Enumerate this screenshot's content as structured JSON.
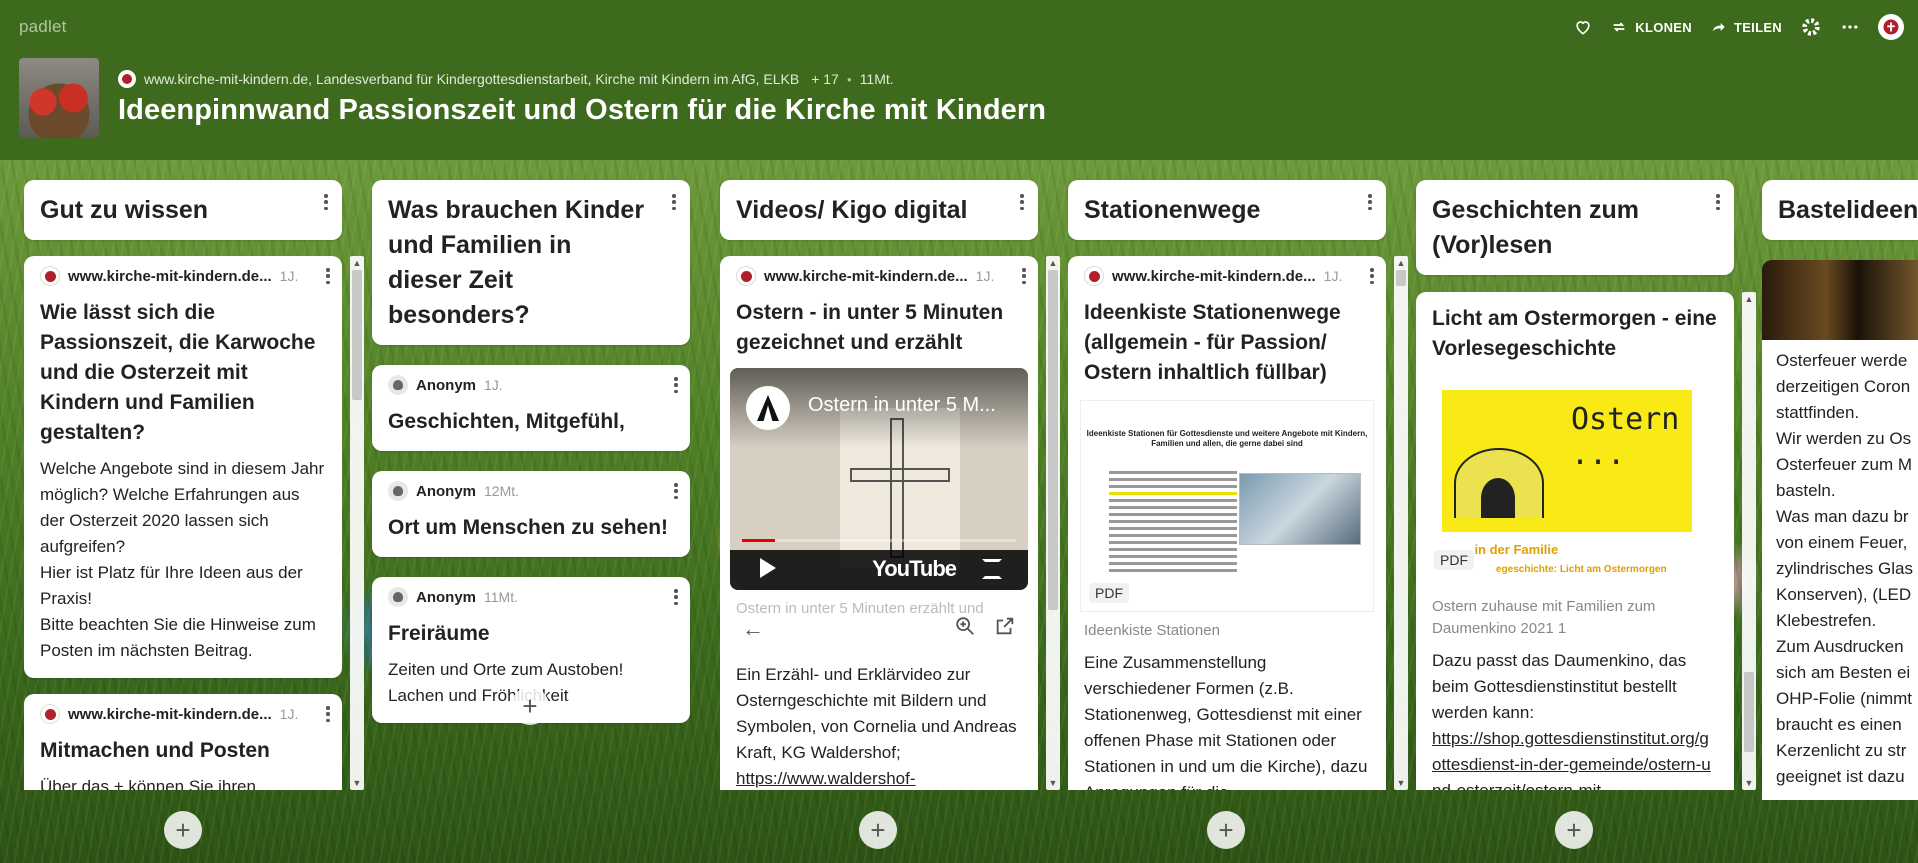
{
  "brand": "padlet",
  "actions": {
    "clone": "KLONEN",
    "share": "TEILEN"
  },
  "header": {
    "author": "www.kirche-mit-kindern.de, Landesverband für Kindergottesdienstarbeit, Kirche mit Kindern im AfG, ELKB",
    "contributors": "+ 17",
    "age": "11Mt.",
    "title": "Ideenpinnwand Passionszeit und Ostern für die Kirche mit Kindern"
  },
  "columns": [
    {
      "title": "Gut zu wissen",
      "cards": [
        {
          "author": "www.kirche-mit-kindern.de...",
          "time": "1J.",
          "title": "Wie lässt sich die Passionszeit, die Karwoche und die Osterzeit mit Kindern und Familien gestalten?",
          "body": [
            "Welche Angebote sind in diesem Jahr möglich? Welche Erfahrungen aus der Osterzeit 2020 lassen sich aufgreifen?",
            "Hier ist Platz für Ihre Ideen aus der Praxis!",
            "Bitte beachten Sie die Hinweise zum Posten im nächsten Beitrag."
          ]
        },
        {
          "author": "www.kirche-mit-kindern.de...",
          "time": "1J.",
          "title": "Mitmachen und Posten",
          "body": [
            "Über das + können Sie ihren"
          ]
        }
      ]
    },
    {
      "title": "Was brauchen Kinder und Familien in dieser Zeit besonders?",
      "cards": [
        {
          "author": "Anonym",
          "time": "1J.",
          "title": "Geschichten, Mitgefühl,"
        },
        {
          "author": "Anonym",
          "time": "12Mt.",
          "title": "Ort um Menschen zu sehen!"
        },
        {
          "author": "Anonym",
          "time": "11Mt.",
          "title": "Freiräume",
          "body": [
            "Zeiten und Orte zum Austoben! Lachen und Fröhlichkeit"
          ]
        }
      ]
    },
    {
      "title": "Videos/ Kigo digital",
      "cards": [
        {
          "author": "www.kirche-mit-kindern.de...",
          "time": "1J.",
          "title": "Ostern - in unter 5 Minuten gezeichnet und erzählt",
          "video_title": "Ostern in unter 5 M...",
          "video_brand": "YouTube",
          "ghost_caption": "Ostern in unter 5 Minuten erzählt und",
          "body": "Ein Erzähl- und Erklärvideo zur Osterngeschichte mit Bildern und Symbolen, von Cornelia und Andreas Kraft, KG Waldershof;",
          "link": "https://www.waldershof-evangelisch.de/"
        }
      ]
    },
    {
      "title": "Stationenwege",
      "cards": [
        {
          "author": "www.kirche-mit-kindern.de...",
          "time": "1J.",
          "title": "Ideenkiste Stationenwege (allgemein - für Passion/ Ostern inhaltlich füllbar)",
          "pdf_heading": "Ideenkiste Stationen für Gottesdienste und weitere Angebote mit Kindern, Familien und allen, die gerne dabei sind",
          "badge": "PDF",
          "file": "Ideenkiste Stationen",
          "body": "Eine Zusammenstellung verschiedener Formen (z.B. Stationenweg, Gottesdienst mit einer offenen Phase mit Stationen oder Stationen in und um die Kirche), dazu Anregungen für die"
        }
      ]
    },
    {
      "title": "Geschichten zum (Vor)lesen",
      "cards": [
        {
          "title": "Licht am Ostermorgen - eine Vorlesegeschichte",
          "pdf_word": "Ostern ...",
          "pdf_family": "... in der Familie",
          "pdf_sub": "egeschichte: Licht am Ostermorgen",
          "badge": "PDF",
          "file": "Ostern zuhause mit Familien zum Daumenkino 2021 1",
          "body": "Dazu passt das Daumenkino, das beim Gottesdienstinstitut bestellt werden kann:",
          "link": "https://shop.gottesdienstinstitut.org/gottesdienst-in-der-gemeinde/ostern-und-osterzeit/ostern-mit-"
        }
      ]
    },
    {
      "title": "Bastelideen",
      "lines": [
        "Osterfeuer werde",
        "derzeitigen Coron",
        "stattfinden.",
        "Wir werden zu Os",
        "Osterfeuer zum M",
        "basteln.",
        "Was man dazu br",
        "von einem Feuer,",
        "zylindrisches Glas",
        "Konserven), (LED",
        "Klebestrefen.",
        "Zum Ausdrucken",
        "sich am Besten ei",
        "OHP-Folie (nimmt",
        "braucht es einen",
        "Kerzenlicht zu str",
        "geeignet ist dazu"
      ]
    }
  ]
}
